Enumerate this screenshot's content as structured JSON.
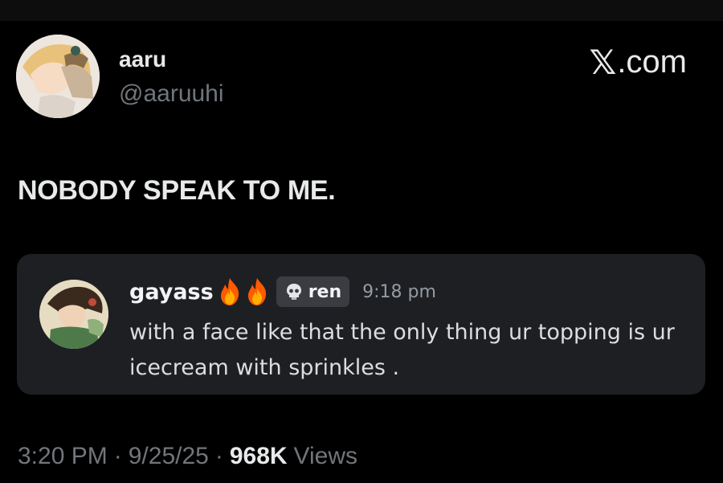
{
  "post": {
    "author": {
      "display_name": "aaru",
      "handle": "@aaruuhi"
    },
    "brand": {
      "x_glyph": "𝕏",
      "suffix": ".com"
    },
    "text": "NOBODY SPEAK TO ME.",
    "embed": {
      "username": "gayass",
      "tag": "ren",
      "tag_icon": "skull-icon",
      "time": "9:18 pm",
      "message": "with a face like that the only thing ur topping is ur icecream with sprinkles ."
    },
    "footer": {
      "time": "3:20 PM",
      "sep": "·",
      "date": "9/25/25",
      "views_count": "968K",
      "views_label": "Views"
    }
  },
  "colors": {
    "background": "#000000",
    "text_primary": "#e7e9ea",
    "text_secondary": "#71767b",
    "card_background": "#1e1f22",
    "tag_background": "#3a3c42",
    "fire": "#ff6a00"
  }
}
